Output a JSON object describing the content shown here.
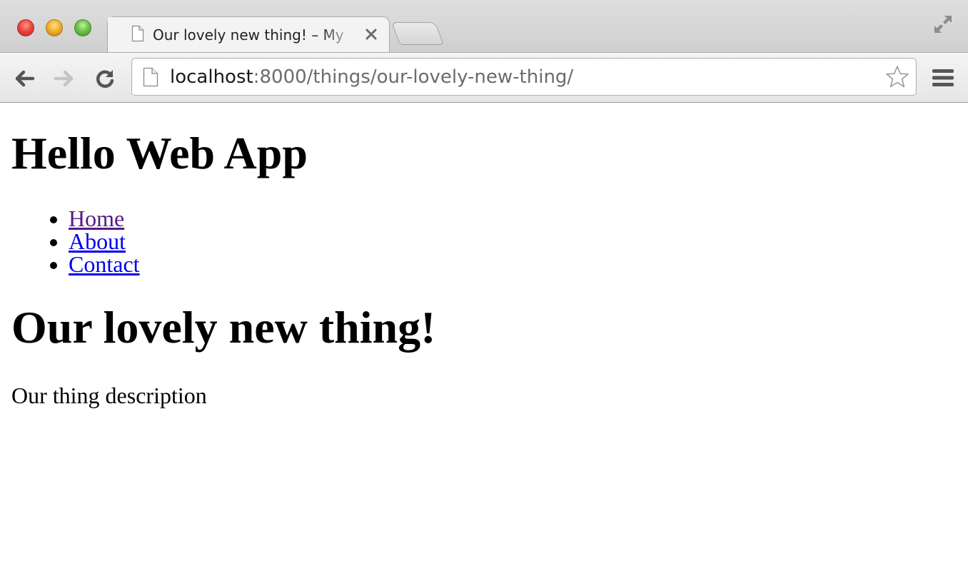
{
  "browser": {
    "tab": {
      "title": "Our lovely new thing! – My",
      "page_icon": "page-icon",
      "close_icon": "close-icon"
    },
    "new_tab_icon": "new-tab-icon",
    "fullscreen_icon": "fullscreen-icon",
    "toolbar": {
      "back_icon": "back-arrow-icon",
      "forward_icon": "forward-arrow-icon",
      "reload_icon": "reload-icon",
      "menu_icon": "hamburger-menu-icon",
      "star_icon": "bookmark-star-icon"
    },
    "address_bar": {
      "host": "localhost",
      "rest": ":8000/things/our-lovely-new-thing/"
    }
  },
  "page": {
    "site_title": "Hello Web App",
    "nav": [
      {
        "label": "Home",
        "visited": true
      },
      {
        "label": "About",
        "visited": false
      },
      {
        "label": "Contact",
        "visited": false
      }
    ],
    "thing": {
      "name": "Our lovely new thing!",
      "description": "Our thing description"
    }
  },
  "colors": {
    "visited_link": "#551a8b",
    "unvisited_link": "#0000ee",
    "url_host": "#1a1a1a",
    "url_rest": "#6b6b6b"
  }
}
